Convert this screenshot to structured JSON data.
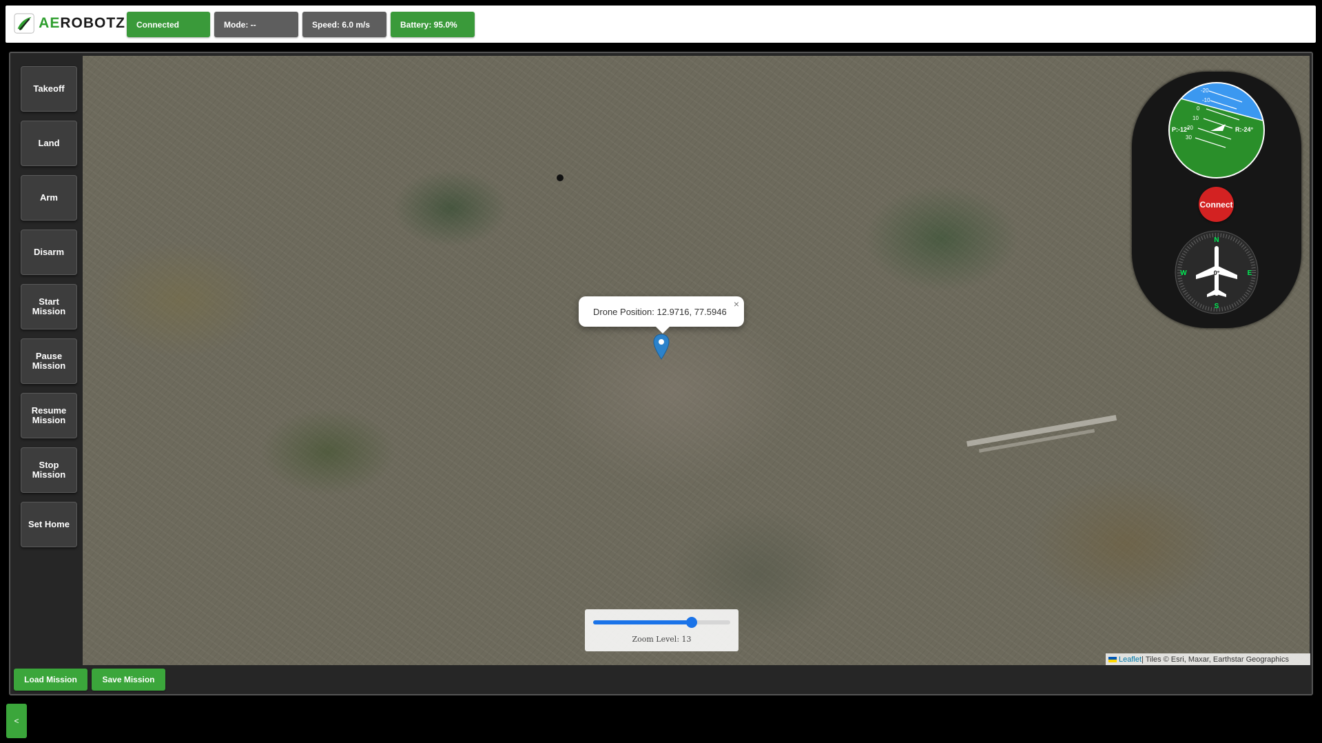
{
  "header": {
    "logo_text_accent": "AE",
    "logo_text_rest": "ROBOTZ",
    "status": "Connected",
    "mode": "Mode: --",
    "speed": "Speed: 6.0 m/s",
    "battery": "Battery: 95.0%"
  },
  "sidebar": {
    "items": [
      {
        "label": "Takeoff"
      },
      {
        "label": "Land"
      },
      {
        "label": "Arm"
      },
      {
        "label": "Disarm"
      },
      {
        "label": "Start\nMission"
      },
      {
        "label": "Pause\nMission"
      },
      {
        "label": "Resume\nMission"
      },
      {
        "label": "Stop\nMission"
      },
      {
        "label": "Set Home"
      }
    ]
  },
  "map": {
    "popup_text": "Drone Position: 12.9716, 77.5946",
    "popup_close": "×",
    "zoom_label": "Zoom Level: 13",
    "zoom_fraction": 0.72,
    "attribution_link": "Leaflet",
    "attribution_text": " | Tiles © Esri, Maxar, Earthstar Geographics"
  },
  "instruments": {
    "pitch_label": "P:-12°",
    "roll_label": "R:-24°",
    "pitch_scale": [
      "-20",
      "-10",
      "0",
      "10",
      "20",
      "30"
    ],
    "connect_label": "Connect",
    "heading_label": "0°",
    "compass": {
      "n": "N",
      "e": "E",
      "s": "S",
      "w": "W"
    },
    "colors": {
      "sky": "#3b98f0",
      "ground": "#2a8f2a",
      "connect": "#d32222"
    }
  },
  "bottom": {
    "load_mission": "Load Mission",
    "save_mission": "Save Mission",
    "toggle": "<"
  }
}
